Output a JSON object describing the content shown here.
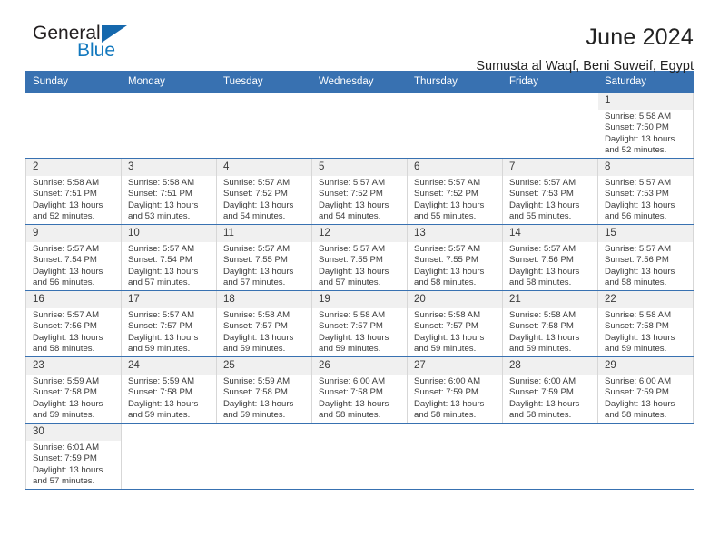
{
  "brand": {
    "line1": "General",
    "line2": "Blue",
    "triangle_color": "#1568ad",
    "blue_text_color": "#1278be"
  },
  "header": {
    "title": "June 2024",
    "subtitle": "Sumusta al Waqf, Beni Suweif, Egypt"
  },
  "theme": {
    "header_row_bg": "#3871b1",
    "header_row_text": "#ffffff",
    "daynum_bg": "#f0f0f0",
    "cell_border": "#3871b1",
    "body_text": "#3a3a3a"
  },
  "weekdays": [
    "Sunday",
    "Monday",
    "Tuesday",
    "Wednesday",
    "Thursday",
    "Friday",
    "Saturday"
  ],
  "labels": {
    "sunrise_prefix": "Sunrise:",
    "sunset_prefix": "Sunset:",
    "daylight_prefix": "Daylight:"
  },
  "weeks": [
    [
      {
        "empty": true
      },
      {
        "empty": true
      },
      {
        "empty": true
      },
      {
        "empty": true
      },
      {
        "empty": true
      },
      {
        "empty": true
      },
      {
        "day": "1",
        "sunrise": "Sunrise: 5:58 AM",
        "sunset": "Sunset: 7:50 PM",
        "daylight_line1": "Daylight: 13 hours",
        "daylight_line2": "and 52 minutes."
      }
    ],
    [
      {
        "day": "2",
        "sunrise": "Sunrise: 5:58 AM",
        "sunset": "Sunset: 7:51 PM",
        "daylight_line1": "Daylight: 13 hours",
        "daylight_line2": "and 52 minutes."
      },
      {
        "day": "3",
        "sunrise": "Sunrise: 5:58 AM",
        "sunset": "Sunset: 7:51 PM",
        "daylight_line1": "Daylight: 13 hours",
        "daylight_line2": "and 53 minutes."
      },
      {
        "day": "4",
        "sunrise": "Sunrise: 5:57 AM",
        "sunset": "Sunset: 7:52 PM",
        "daylight_line1": "Daylight: 13 hours",
        "daylight_line2": "and 54 minutes."
      },
      {
        "day": "5",
        "sunrise": "Sunrise: 5:57 AM",
        "sunset": "Sunset: 7:52 PM",
        "daylight_line1": "Daylight: 13 hours",
        "daylight_line2": "and 54 minutes."
      },
      {
        "day": "6",
        "sunrise": "Sunrise: 5:57 AM",
        "sunset": "Sunset: 7:52 PM",
        "daylight_line1": "Daylight: 13 hours",
        "daylight_line2": "and 55 minutes."
      },
      {
        "day": "7",
        "sunrise": "Sunrise: 5:57 AM",
        "sunset": "Sunset: 7:53 PM",
        "daylight_line1": "Daylight: 13 hours",
        "daylight_line2": "and 55 minutes."
      },
      {
        "day": "8",
        "sunrise": "Sunrise: 5:57 AM",
        "sunset": "Sunset: 7:53 PM",
        "daylight_line1": "Daylight: 13 hours",
        "daylight_line2": "and 56 minutes."
      }
    ],
    [
      {
        "day": "9",
        "sunrise": "Sunrise: 5:57 AM",
        "sunset": "Sunset: 7:54 PM",
        "daylight_line1": "Daylight: 13 hours",
        "daylight_line2": "and 56 minutes."
      },
      {
        "day": "10",
        "sunrise": "Sunrise: 5:57 AM",
        "sunset": "Sunset: 7:54 PM",
        "daylight_line1": "Daylight: 13 hours",
        "daylight_line2": "and 57 minutes."
      },
      {
        "day": "11",
        "sunrise": "Sunrise: 5:57 AM",
        "sunset": "Sunset: 7:55 PM",
        "daylight_line1": "Daylight: 13 hours",
        "daylight_line2": "and 57 minutes."
      },
      {
        "day": "12",
        "sunrise": "Sunrise: 5:57 AM",
        "sunset": "Sunset: 7:55 PM",
        "daylight_line1": "Daylight: 13 hours",
        "daylight_line2": "and 57 minutes."
      },
      {
        "day": "13",
        "sunrise": "Sunrise: 5:57 AM",
        "sunset": "Sunset: 7:55 PM",
        "daylight_line1": "Daylight: 13 hours",
        "daylight_line2": "and 58 minutes."
      },
      {
        "day": "14",
        "sunrise": "Sunrise: 5:57 AM",
        "sunset": "Sunset: 7:56 PM",
        "daylight_line1": "Daylight: 13 hours",
        "daylight_line2": "and 58 minutes."
      },
      {
        "day": "15",
        "sunrise": "Sunrise: 5:57 AM",
        "sunset": "Sunset: 7:56 PM",
        "daylight_line1": "Daylight: 13 hours",
        "daylight_line2": "and 58 minutes."
      }
    ],
    [
      {
        "day": "16",
        "sunrise": "Sunrise: 5:57 AM",
        "sunset": "Sunset: 7:56 PM",
        "daylight_line1": "Daylight: 13 hours",
        "daylight_line2": "and 58 minutes."
      },
      {
        "day": "17",
        "sunrise": "Sunrise: 5:57 AM",
        "sunset": "Sunset: 7:57 PM",
        "daylight_line1": "Daylight: 13 hours",
        "daylight_line2": "and 59 minutes."
      },
      {
        "day": "18",
        "sunrise": "Sunrise: 5:58 AM",
        "sunset": "Sunset: 7:57 PM",
        "daylight_line1": "Daylight: 13 hours",
        "daylight_line2": "and 59 minutes."
      },
      {
        "day": "19",
        "sunrise": "Sunrise: 5:58 AM",
        "sunset": "Sunset: 7:57 PM",
        "daylight_line1": "Daylight: 13 hours",
        "daylight_line2": "and 59 minutes."
      },
      {
        "day": "20",
        "sunrise": "Sunrise: 5:58 AM",
        "sunset": "Sunset: 7:57 PM",
        "daylight_line1": "Daylight: 13 hours",
        "daylight_line2": "and 59 minutes."
      },
      {
        "day": "21",
        "sunrise": "Sunrise: 5:58 AM",
        "sunset": "Sunset: 7:58 PM",
        "daylight_line1": "Daylight: 13 hours",
        "daylight_line2": "and 59 minutes."
      },
      {
        "day": "22",
        "sunrise": "Sunrise: 5:58 AM",
        "sunset": "Sunset: 7:58 PM",
        "daylight_line1": "Daylight: 13 hours",
        "daylight_line2": "and 59 minutes."
      }
    ],
    [
      {
        "day": "23",
        "sunrise": "Sunrise: 5:59 AM",
        "sunset": "Sunset: 7:58 PM",
        "daylight_line1": "Daylight: 13 hours",
        "daylight_line2": "and 59 minutes."
      },
      {
        "day": "24",
        "sunrise": "Sunrise: 5:59 AM",
        "sunset": "Sunset: 7:58 PM",
        "daylight_line1": "Daylight: 13 hours",
        "daylight_line2": "and 59 minutes."
      },
      {
        "day": "25",
        "sunrise": "Sunrise: 5:59 AM",
        "sunset": "Sunset: 7:58 PM",
        "daylight_line1": "Daylight: 13 hours",
        "daylight_line2": "and 59 minutes."
      },
      {
        "day": "26",
        "sunrise": "Sunrise: 6:00 AM",
        "sunset": "Sunset: 7:58 PM",
        "daylight_line1": "Daylight: 13 hours",
        "daylight_line2": "and 58 minutes."
      },
      {
        "day": "27",
        "sunrise": "Sunrise: 6:00 AM",
        "sunset": "Sunset: 7:59 PM",
        "daylight_line1": "Daylight: 13 hours",
        "daylight_line2": "and 58 minutes."
      },
      {
        "day": "28",
        "sunrise": "Sunrise: 6:00 AM",
        "sunset": "Sunset: 7:59 PM",
        "daylight_line1": "Daylight: 13 hours",
        "daylight_line2": "and 58 minutes."
      },
      {
        "day": "29",
        "sunrise": "Sunrise: 6:00 AM",
        "sunset": "Sunset: 7:59 PM",
        "daylight_line1": "Daylight: 13 hours",
        "daylight_line2": "and 58 minutes."
      }
    ],
    [
      {
        "day": "30",
        "sunrise": "Sunrise: 6:01 AM",
        "sunset": "Sunset: 7:59 PM",
        "daylight_line1": "Daylight: 13 hours",
        "daylight_line2": "and 57 minutes."
      },
      {
        "empty": true
      },
      {
        "empty": true
      },
      {
        "empty": true
      },
      {
        "empty": true
      },
      {
        "empty": true
      },
      {
        "empty": true
      }
    ]
  ]
}
